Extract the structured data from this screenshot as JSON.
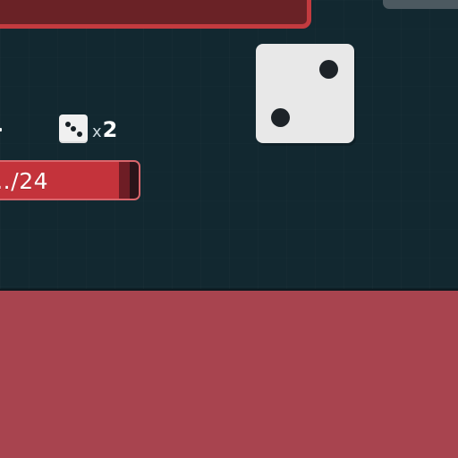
{
  "game": {
    "dice_multiplier": {
      "prefix": "x",
      "value": "2",
      "icon": "dice-icon"
    },
    "health": {
      "current": "…/24",
      "fill_fraction": 0.94,
      "bar_color": "#c4333b",
      "border_color": "#d9666c"
    },
    "roll_die": {
      "face_value": 2,
      "icon": "die-face-2-icon"
    },
    "colors": {
      "board": "#122830",
      "lower_panel": "#a8444f",
      "banner": "#6a2226",
      "banner_border": "#c33b3f"
    }
  }
}
